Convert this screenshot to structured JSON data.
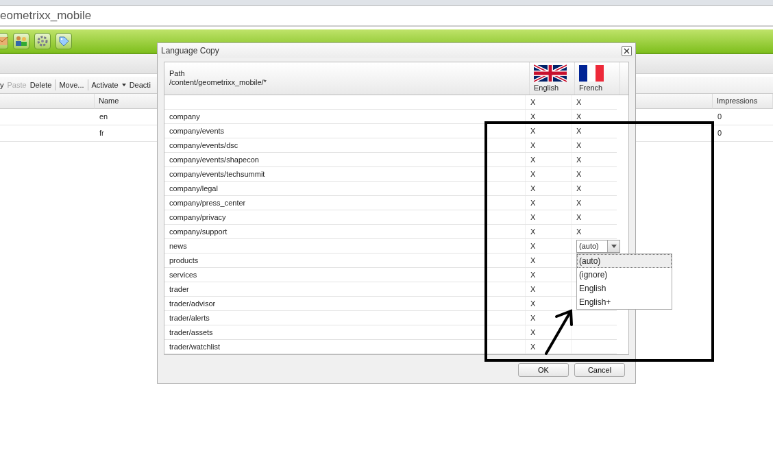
{
  "address": "eometrixx_mobile",
  "actions": [
    {
      "label": "y",
      "disabled": false
    },
    {
      "label": "Paste",
      "disabled": true
    },
    {
      "label": "Delete",
      "disabled": false
    },
    {
      "label": "Move...",
      "disabled": false
    },
    {
      "label": "Activate",
      "disabled": false,
      "menu": true
    },
    {
      "label": "Deacti",
      "disabled": false
    }
  ],
  "grid": {
    "columns": [
      "Name",
      "Impressions"
    ],
    "rows": [
      [
        "en",
        "0"
      ],
      [
        "fr",
        "0"
      ]
    ]
  },
  "dialog": {
    "title": "Language Copy",
    "path_label": "Path",
    "path": "/content/geometrixx_mobile/*",
    "languages": [
      "English",
      "French"
    ],
    "rows": [
      {
        "path": "",
        "english": "X",
        "french": {
          "kind": "text",
          "text": "X"
        }
      },
      {
        "path": "company",
        "english": "X",
        "french": {
          "kind": "text",
          "text": "X"
        }
      },
      {
        "path": "company/events",
        "english": "X",
        "french": {
          "kind": "text",
          "text": "X"
        }
      },
      {
        "path": "company/events/dsc",
        "english": "X",
        "french": {
          "kind": "text",
          "text": "X"
        }
      },
      {
        "path": "company/events/shapecon",
        "english": "X",
        "french": {
          "kind": "text",
          "text": "X"
        }
      },
      {
        "path": "company/events/techsummit",
        "english": "X",
        "french": {
          "kind": "text",
          "text": "X"
        }
      },
      {
        "path": "company/legal",
        "english": "X",
        "french": {
          "kind": "text",
          "text": "X"
        }
      },
      {
        "path": "company/press_center",
        "english": "X",
        "french": {
          "kind": "text",
          "text": "X"
        }
      },
      {
        "path": "company/privacy",
        "english": "X",
        "french": {
          "kind": "text",
          "text": "X"
        }
      },
      {
        "path": "company/support",
        "english": "X",
        "french": {
          "kind": "text",
          "text": "X"
        }
      },
      {
        "path": "news",
        "english": "X",
        "french": {
          "kind": "select",
          "value": "(auto)"
        }
      },
      {
        "path": "products",
        "english": "X"
      },
      {
        "path": "services",
        "english": "X"
      },
      {
        "path": "trader",
        "english": "X"
      },
      {
        "path": "trader/advisor",
        "english": "X"
      },
      {
        "path": "trader/alerts",
        "english": "X"
      },
      {
        "path": "trader/assets",
        "english": "X"
      },
      {
        "path": "trader/watchlist",
        "english": "X"
      }
    ],
    "options": [
      {
        "label": "(auto)",
        "selected": true
      },
      {
        "label": "(ignore)",
        "selected": false
      },
      {
        "label": "English",
        "selected": false
      },
      {
        "label": "English+",
        "selected": false
      }
    ],
    "buttons": [
      "OK",
      "Cancel"
    ]
  }
}
